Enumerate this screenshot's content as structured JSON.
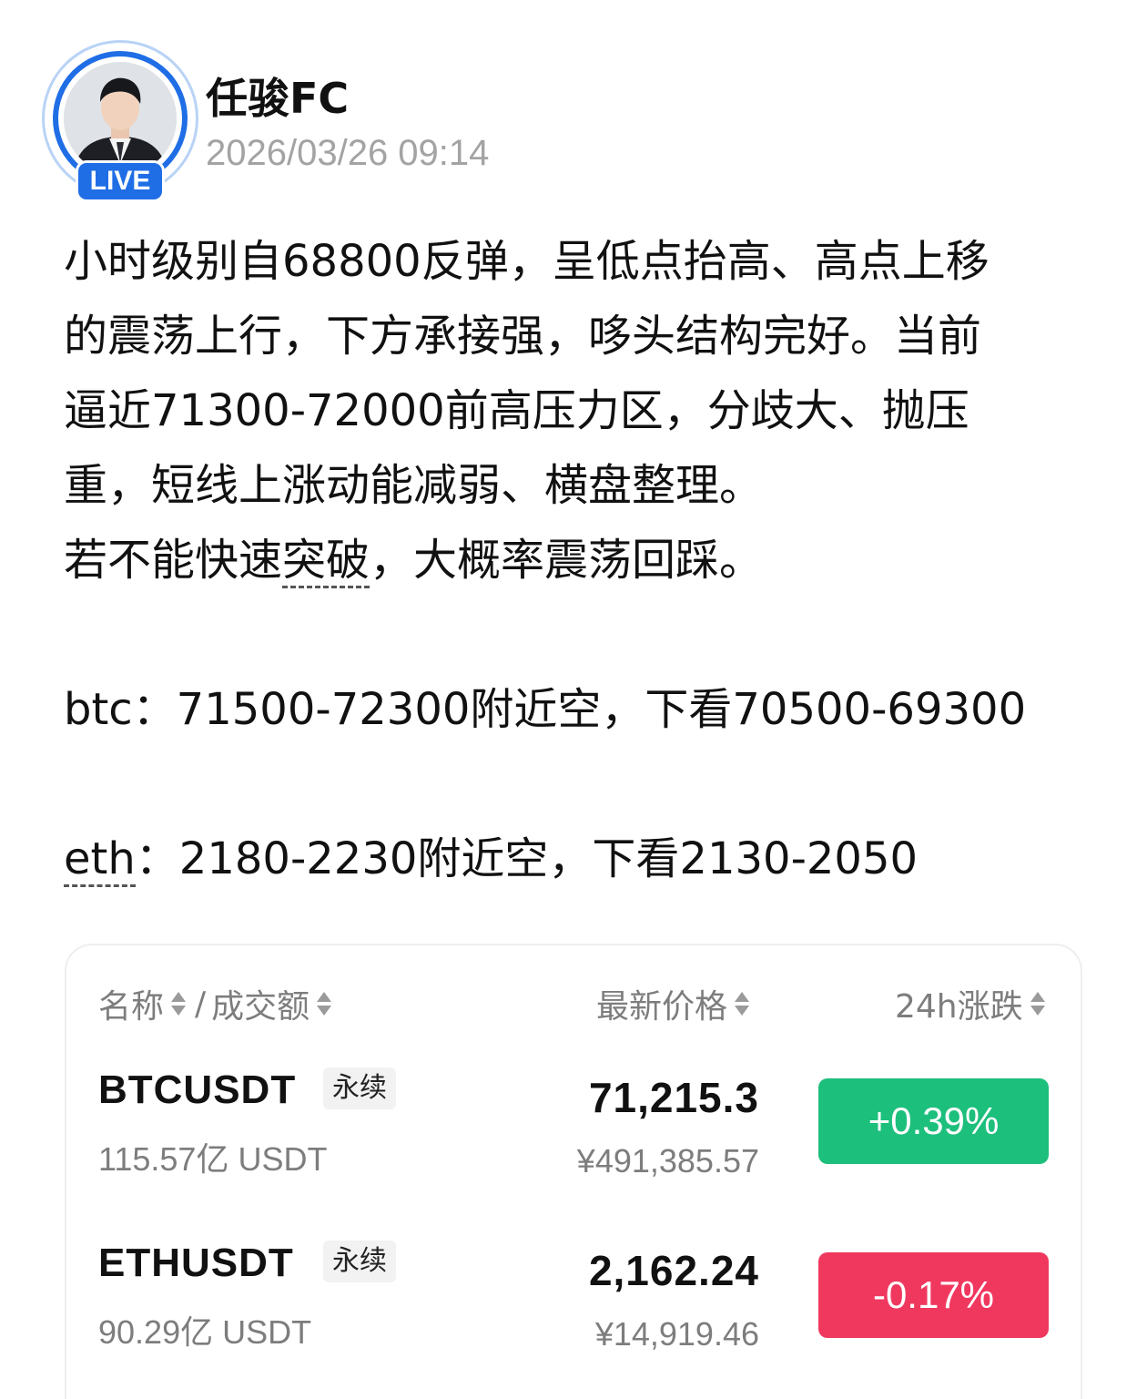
{
  "author": {
    "name": "任骏FC",
    "timestamp": "2026/03/26 09:14",
    "live_badge": "LIVE"
  },
  "post": {
    "lines": [
      "小时级别自68800反弹，呈低点抬高、高点上移",
      "的震荡上行，下方承接强，哆头结构完好。当前",
      "逼近71300-72000前高压力区，分歧大、抛压",
      "重，短线上涨动能减弱、横盘整理。"
    ],
    "line5_a": "若不能快速",
    "line5_b": "突破",
    "line5_c": "，大概率震荡回踩。",
    "btc_line": "btc：71500-72300附近空，下看70500-69300",
    "eth_a": "eth",
    "eth_b": "：2180-2230附近空，下看2130-2050"
  },
  "market": {
    "headers": {
      "name": "名称",
      "sep": "/",
      "volume": "成交额",
      "price": "最新价格",
      "change": "24h涨跌"
    },
    "rows": [
      {
        "symbol": "BTCUSDT",
        "tag": "永续",
        "volume": "115.57亿 USDT",
        "price": "71,215.3",
        "cny": "¥491,385.57",
        "change": "+0.39%",
        "change_color": "#1dbf7c"
      },
      {
        "symbol": "ETHUSDT",
        "tag": "永续",
        "volume": "90.29亿 USDT",
        "price": "2,162.24",
        "cny": "¥14,919.46",
        "change": "-0.17%",
        "change_color": "#f0385f"
      }
    ]
  }
}
